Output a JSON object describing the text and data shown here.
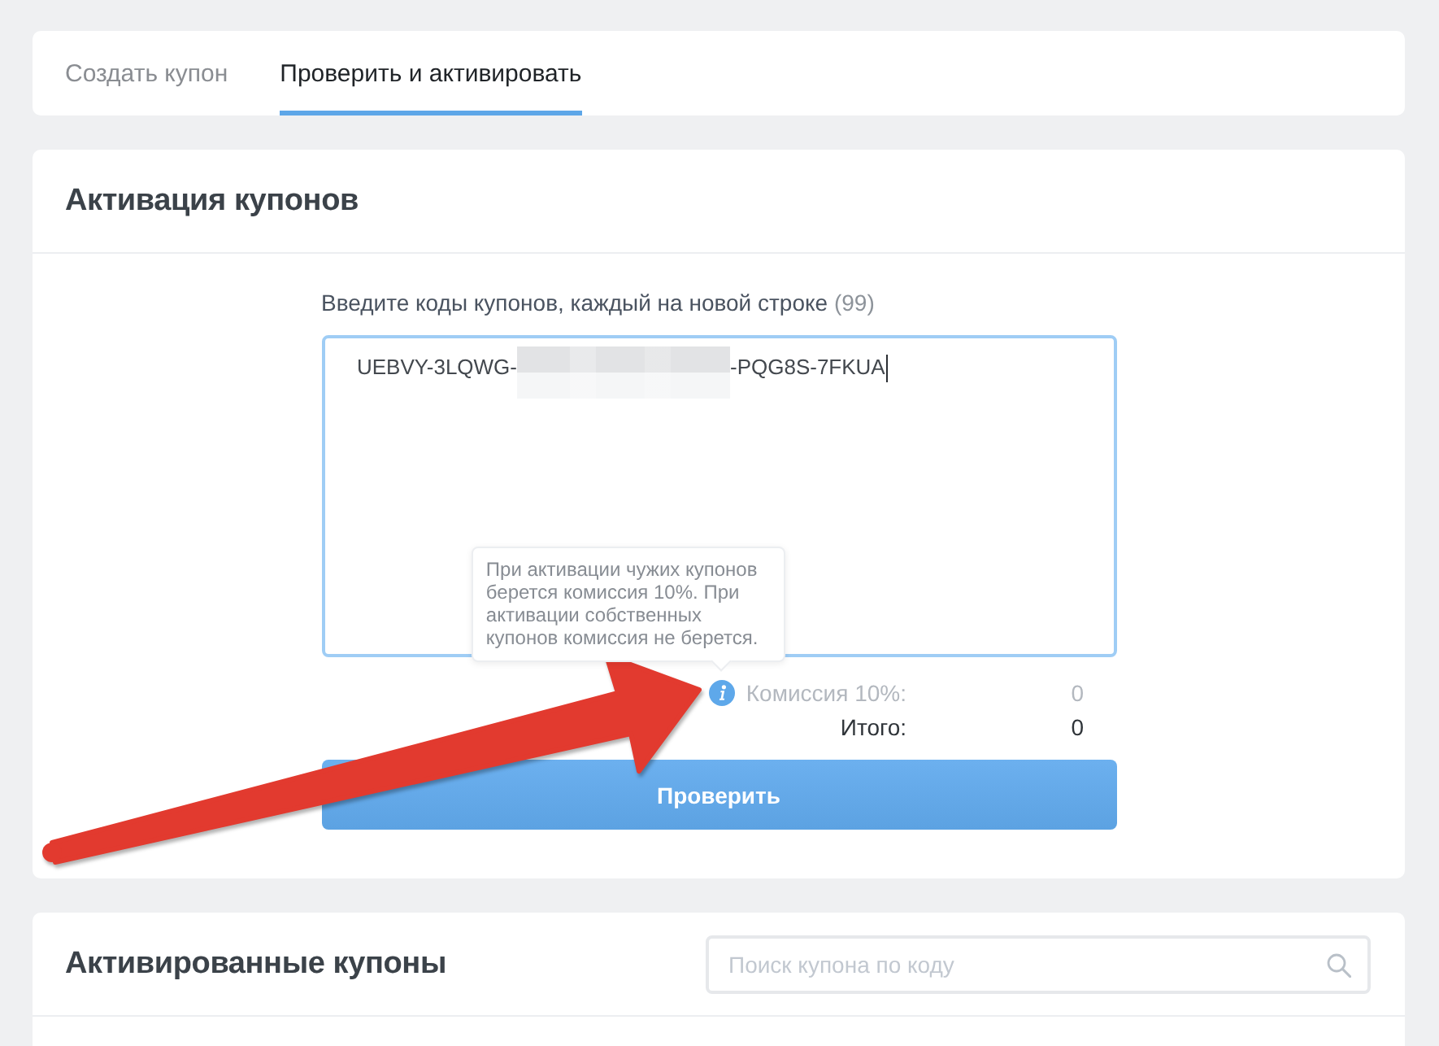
{
  "tabs": [
    {
      "label": "Создать купон",
      "selected": false
    },
    {
      "label": "Проверить и активировать",
      "selected": true
    }
  ],
  "activation": {
    "title": "Активация купонов",
    "field_label": "Введите коды купонов, каждый на новой строке",
    "field_count": "(99)",
    "codes_field": {
      "value_start": "UEBVY-3LQWG-",
      "redacted": true,
      "value_end": "-PQG8S-7FKUA",
      "focused": true
    },
    "summary": [
      {
        "kind": "fee",
        "label": "Комиссия 10%:",
        "value": "0",
        "tooltip": "При активации чужих купонов берется комиссия 10%. При активации собственных купонов комиссия не берется."
      },
      {
        "kind": "total",
        "label": "Итого:",
        "value": "0"
      }
    ],
    "button": "Проверить"
  },
  "activated": {
    "title": "Активированные купоны",
    "search": {
      "placeholder": "Поиск купона по коду"
    }
  },
  "annotation": {
    "kind": "arrow"
  }
}
